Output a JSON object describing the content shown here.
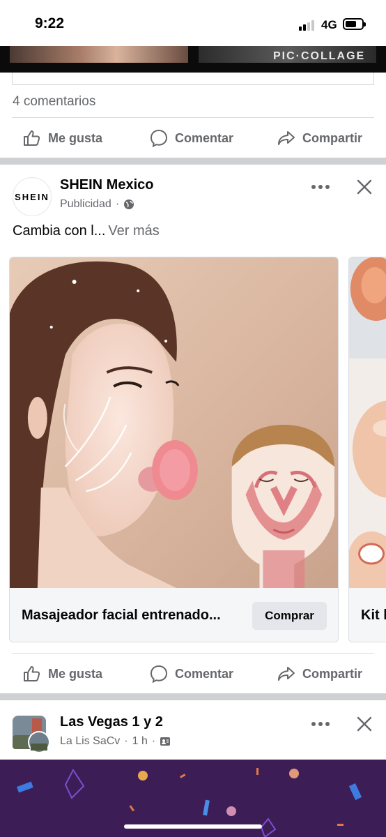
{
  "status_bar": {
    "time": "9:22",
    "network": "4G",
    "signal_bars": 2,
    "signal_bars_total": 4
  },
  "previous_post": {
    "photo_watermark": "PIC·COLLAGE",
    "comments_count": "4 comentarios"
  },
  "actions": {
    "like": "Me gusta",
    "comment": "Comentar",
    "share": "Compartir"
  },
  "ad_post": {
    "avatar_text": "SHEIN",
    "page_name": "SHEIN Mexico",
    "sponsored_label": "Publicidad",
    "audience_icon": "globe-icon",
    "text": "Cambia con l...",
    "see_more": "Ver más",
    "cards": [
      {
        "title": "Masajeador facial entrenado...",
        "cta": "Comprar"
      },
      {
        "title": "Kit l"
      }
    ]
  },
  "next_post": {
    "group_name": "Las Vegas 1 y 2",
    "author": "La Lis SaCv",
    "time": "1 h",
    "audience_icon": "group-icon"
  },
  "colors": {
    "secondary_text": "#65676b",
    "separator": "#cfd0d4",
    "button_bg": "#e4e6eb",
    "promo_bg": "#3c1d55"
  }
}
